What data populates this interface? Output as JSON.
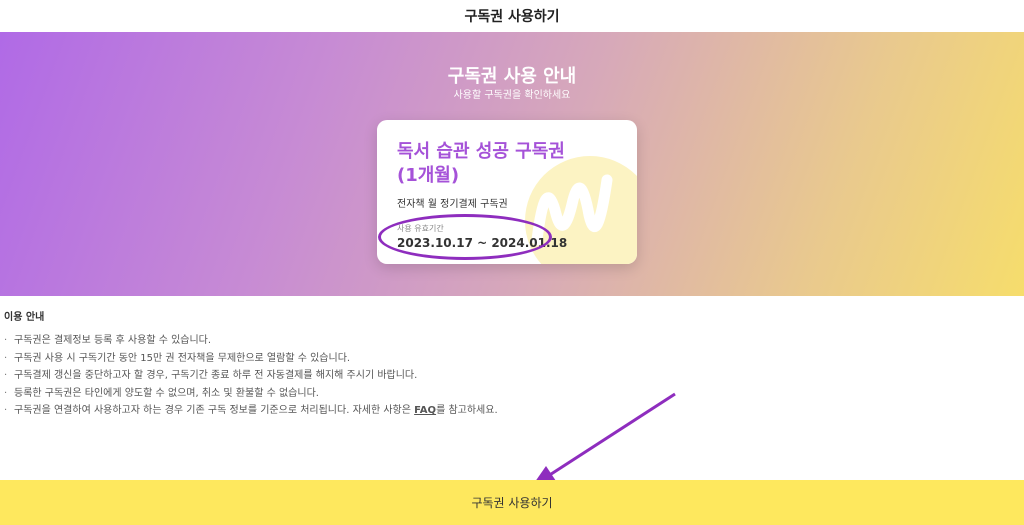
{
  "header": {
    "title": "구독권 사용하기"
  },
  "hero": {
    "title": "구독권 사용 안내",
    "subtitle": "사용할 구독권을 확인하세요"
  },
  "card": {
    "title": "독서 습관 성공 구독권 (1개월)",
    "description": "전자책 월 정기결제 구독권",
    "period_label": "사용 유효기간",
    "period_value": "2023.10.17 ~ 2024.01.18"
  },
  "notice": {
    "title": "이용 안내",
    "items": [
      "구독권은 결제정보 등록 후 사용할 수 있습니다.",
      "구독권 사용 시 구독기간 동안 15만 권 전자책을 무제한으로 열람할 수 있습니다.",
      "구독결제 갱신을 중단하고자 할 경우, 구독기간 종료 하루 전 자동결제를 해지해 주시기 바랍니다.",
      "등록한 구독권은 타인에게 양도할 수 없으며, 취소 및 환불할 수 없습니다."
    ],
    "last_item_prefix": "구독권을 연결하여 사용하고자 하는 경우 기존 구독 정보를 기준으로 처리됩니다. 자세한 사항은 ",
    "faq_link": "FAQ",
    "last_item_suffix": "를 참고하세요."
  },
  "footer": {
    "button_label": "구독권 사용하기"
  },
  "colors": {
    "accent_purple": "#a552d8",
    "annotation_purple": "#8e2dbe",
    "button_yellow": "#fee85e"
  },
  "icons": {
    "card_decoration": "wave-icon",
    "annotation_arrow": "arrow-icon"
  }
}
